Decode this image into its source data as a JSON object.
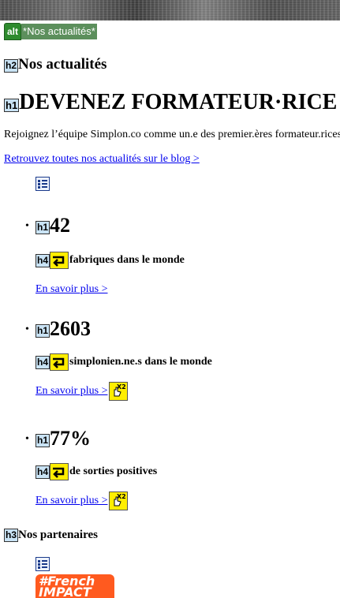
{
  "alt": {
    "badge": "alt",
    "text": "*Nos actualités*"
  },
  "tags": {
    "h1": "h1",
    "h2": "h2",
    "h3": "h3",
    "h4": "h4"
  },
  "news": {
    "heading": "Nos actualités",
    "title": "DEVENEZ FORMATEUR·RICE",
    "lead": "Rejoignez l’équipe Simplon.co comme un.e des premier.ères formateur.rices",
    "blog_link": "Retrouvez toutes nos actualités sur le blog >"
  },
  "stats": [
    {
      "number": "42",
      "label": "fabriques dans le monde",
      "link": "En savoir plus >"
    },
    {
      "number": "2603",
      "label": "simplonien.ne.s dans le monde",
      "link": "En savoir plus >"
    },
    {
      "number": "77%",
      "label": "de sorties positives",
      "link": "En savoir plus >"
    }
  ],
  "partners": {
    "heading": "Nos partenaires",
    "logo_text": "#French IMPACT"
  },
  "icons": {
    "list": "list-icon",
    "arrow": "return-arrow-icon",
    "double_click": "double-click-icon"
  },
  "colors": {
    "tag_bg": "#c9e3f5",
    "icon_bg": "#ffee00",
    "alt_badge": "#2e8b2e",
    "link": "#0000ee",
    "logo": "#ff5a1f"
  }
}
